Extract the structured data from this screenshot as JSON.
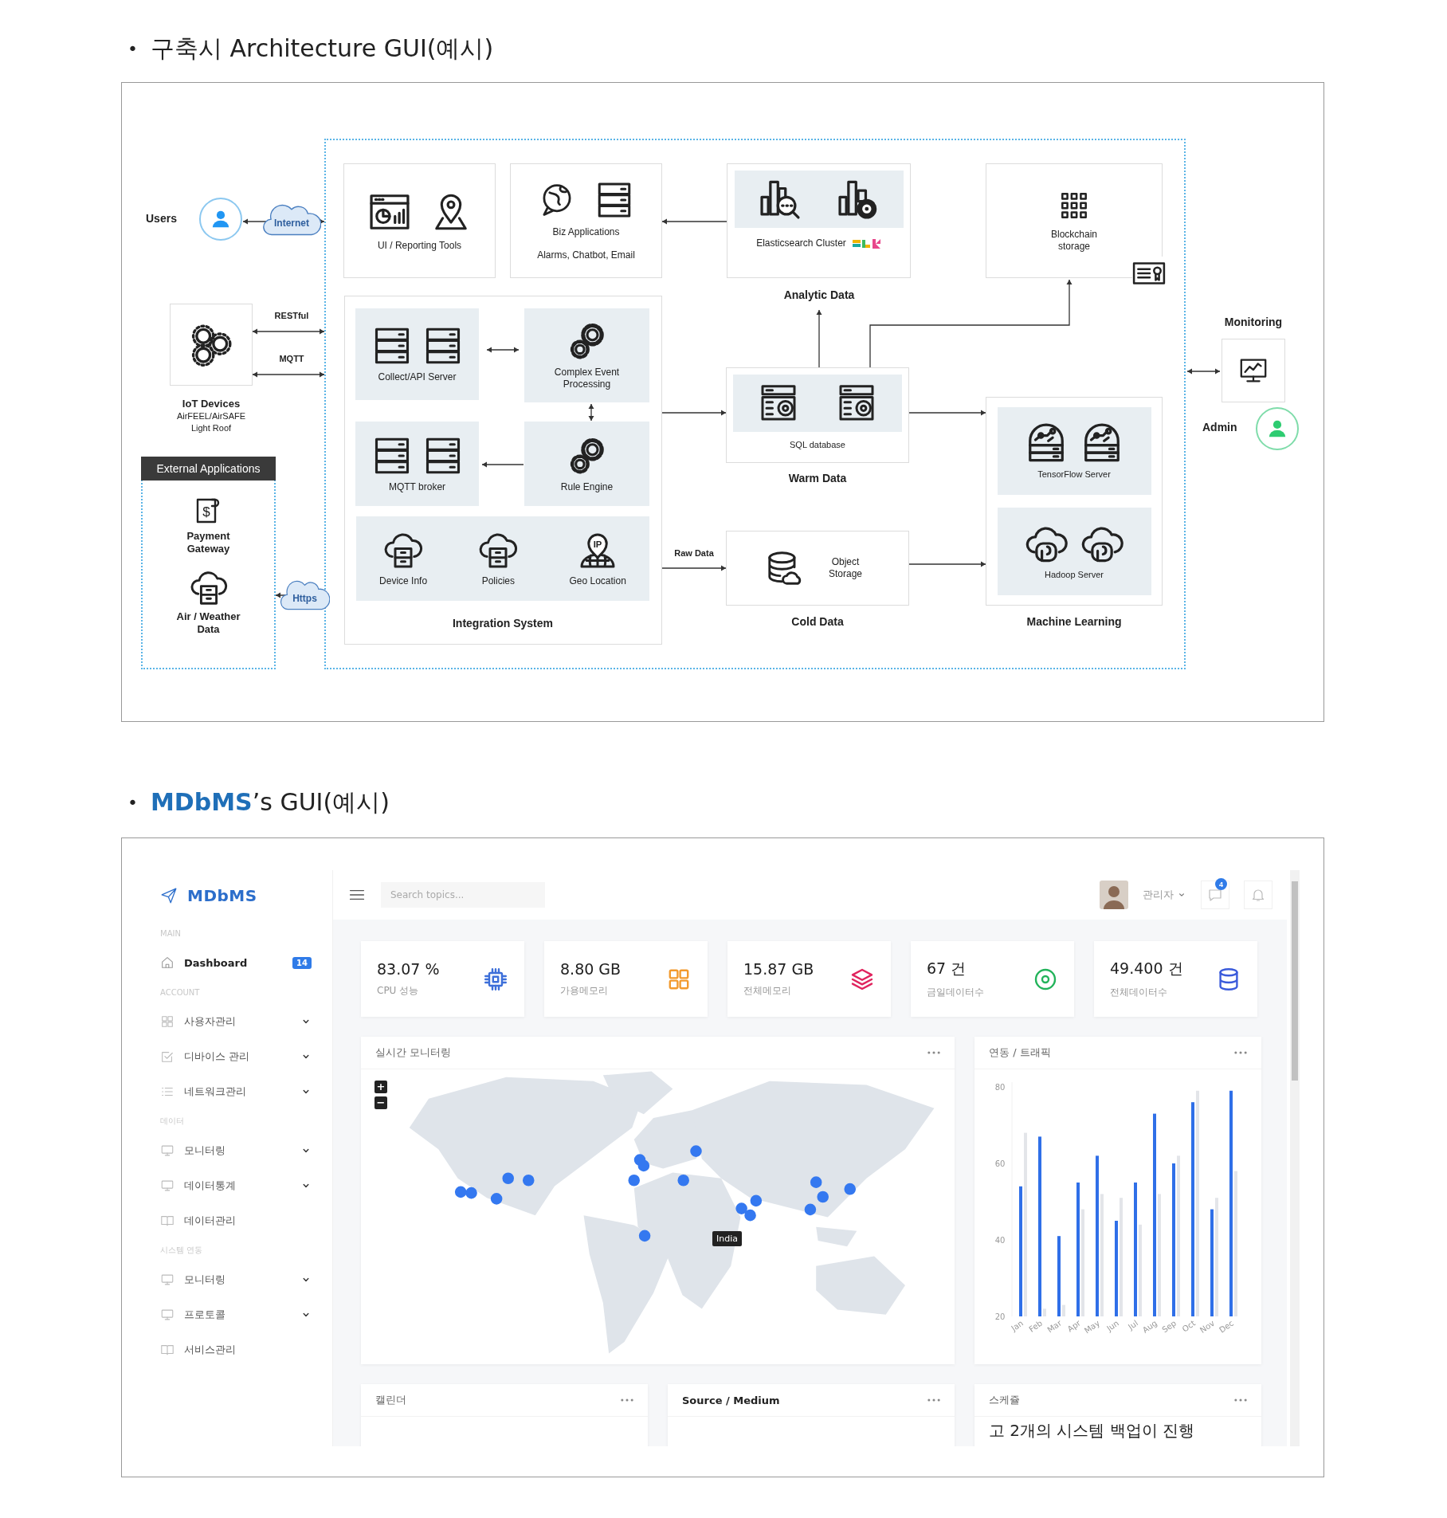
{
  "sections": [
    {
      "bullet": "•",
      "title": "구축시 Architecture GUI(예시)"
    },
    {
      "bullet": "•",
      "highlight": "MDbMS",
      "title": "’s GUI(예시)"
    }
  ],
  "architecture": {
    "users": "Users",
    "internet": "Internet",
    "https": "Https",
    "links": [
      "RESTful",
      "MQTT",
      "Raw Data"
    ],
    "iot": {
      "title": "IoT Devices",
      "lines": [
        "AirFEEL/AirSAFE",
        "Light Roof"
      ]
    },
    "external": {
      "title": "External Applications",
      "items": [
        {
          "label": "Payment Gateway",
          "symbol": "$"
        },
        {
          "label": "Air / Weather Data"
        }
      ]
    },
    "top_boxes": [
      {
        "label": "UI / Reporting Tools"
      },
      {
        "label": "Biz Applications",
        "caption": "Alarms, Chatbot, Email"
      },
      {
        "label": "Elasticsearch Cluster"
      },
      {
        "label": "Blockchain storage"
      }
    ],
    "analytic": "Analytic Data",
    "integration": {
      "title": "Integration System",
      "modules": [
        "Collect/API Server",
        "Complex Event Processing",
        "MQTT broker",
        "Rule Engine"
      ],
      "services": [
        {
          "label": "Device Info"
        },
        {
          "label": "Policies"
        },
        {
          "label": "Geo Location",
          "symbol": "IP"
        }
      ]
    },
    "warm": {
      "item": "SQL database",
      "title": "Warm Data"
    },
    "cold": {
      "item": "Object Storage",
      "title": "Cold Data"
    },
    "ml": {
      "title": "Machine Learning",
      "items": [
        "TensorFlow Server",
        "Hadoop Server"
      ]
    },
    "monitoring": "Monitoring",
    "admin": "Admin"
  },
  "dashboard": {
    "logo": "MDbMS",
    "nav": [
      {
        "label": "MAIN",
        "items": [
          {
            "label": "Dashboard",
            "selected": true,
            "expandable": false,
            "badge": "14"
          }
        ]
      },
      {
        "label": "ACCOUNT",
        "items": [
          {
            "label": "사용자관리",
            "selected": false,
            "expandable": true
          },
          {
            "label": "디바이스 관리",
            "selected": false,
            "expandable": true
          },
          {
            "label": "네트워크관리",
            "selected": false,
            "expandable": true
          }
        ]
      },
      {
        "label": "데이터",
        "items": [
          {
            "label": "모니터링",
            "selected": false,
            "expandable": true
          },
          {
            "label": "데이터통계",
            "selected": false,
            "expandable": true
          },
          {
            "label": "데이터관리",
            "selected": false,
            "expandable": false
          }
        ]
      },
      {
        "label": "시스템 연동",
        "items": [
          {
            "label": "모니터링",
            "selected": false,
            "expandable": true
          },
          {
            "label": "프로토콜",
            "selected": false,
            "expandable": true
          },
          {
            "label": "서비스관리",
            "selected": false,
            "expandable": false
          }
        ]
      }
    ],
    "search": {
      "placeholder": "Search topics..."
    },
    "user": {
      "name": "관리자"
    },
    "message_badge": "4",
    "stats": [
      {
        "value": "83.07 %",
        "label": "CPU 성능",
        "color": "#3d6fd9"
      },
      {
        "value": "8.80 GB",
        "label": "가용메모리",
        "color": "#f29a2e"
      },
      {
        "value": "15.87 GB",
        "label": "전체메모리",
        "color": "#e0245e"
      },
      {
        "value": "67 건",
        "label": "금일데이터수",
        "color": "#22b35a"
      },
      {
        "value": "49.400 건",
        "label": "전체데이터수",
        "color": "#3b5bdb"
      }
    ],
    "map_card": {
      "title": "실시간 모니터링",
      "zoom": [
        "+",
        "−"
      ],
      "tooltip": "India"
    },
    "traffic_card": {
      "title": "연동 / 트래픽",
      "chart_data": {
        "type": "bar",
        "categories": [
          "Jan",
          "Feb",
          "Mar",
          "Apr",
          "May",
          "Jun",
          "Jul",
          "Aug",
          "Sep",
          "Oct",
          "Nov",
          "Dec"
        ],
        "series": [
          {
            "color": "#2f6fe8",
            "values": [
              54,
              67,
              41,
              55,
              62,
              45,
              55,
              73,
              60,
              76,
              48,
              79
            ]
          },
          {
            "color": "#e3e5e9",
            "values": [
              68,
              22,
              23,
              48,
              52,
              51,
              44,
              52,
              62,
              79,
              51,
              58
            ]
          }
        ],
        "ylim": [
          20,
          80
        ],
        "yticks": [
          20,
          40,
          60,
          80
        ]
      }
    },
    "bottom_cards": [
      {
        "title": "캘린더",
        "bold": false
      },
      {
        "title": "Source / Medium",
        "bold": true
      },
      {
        "title": "스케쥴",
        "bold": false,
        "text": "고 2개의 시스템 백업이 진행"
      }
    ]
  }
}
